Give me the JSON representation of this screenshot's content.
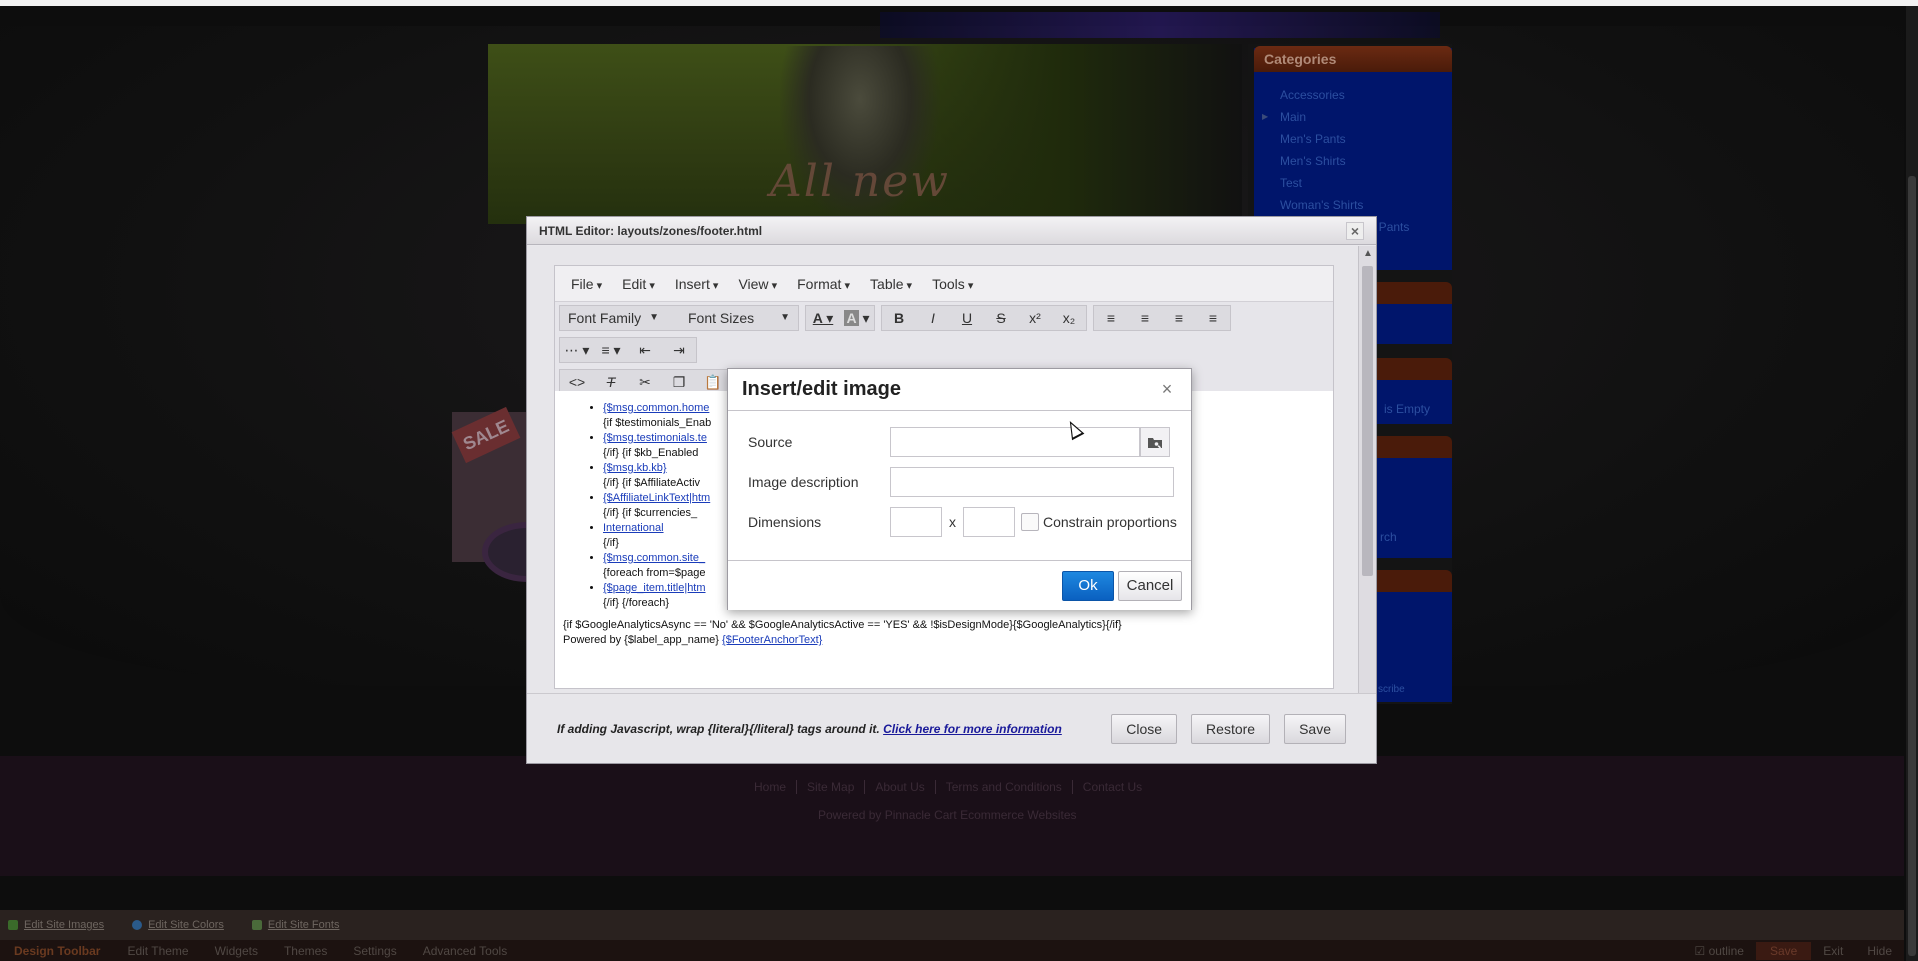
{
  "background_site": {
    "banner_text": "All new",
    "sale_tag": "SALE",
    "categories": {
      "title": "Categories",
      "items": [
        "Accessories",
        "Main",
        "Men's Pants",
        "Men's Shirts",
        "Test",
        "Woman's Shirts",
        "And Pants"
      ]
    },
    "sidebar_fragments": [
      "is Empty",
      "rch",
      "scribe"
    ],
    "footer_links": [
      "Home",
      "Site Map",
      "About Us",
      "Terms and Conditions",
      "Contact Us"
    ],
    "footer_powered": "Powered by Pinnacle Cart Ecommerce Websites"
  },
  "edit_toolbar": {
    "items": [
      {
        "label": "Edit Site Images",
        "color": "#3a6a2a"
      },
      {
        "label": "Edit Site Colors",
        "color": "#2a5a8a"
      },
      {
        "label": "Edit Site Fonts",
        "color": "#4a6a3a"
      }
    ]
  },
  "design_toolbar": {
    "brand": "Design Toolbar",
    "nav": [
      "Edit Theme",
      "Widgets",
      "Themes",
      "Settings",
      "Advanced Tools"
    ],
    "outline": "outline",
    "save": "Save",
    "exit": "Exit",
    "hide": "Hide"
  },
  "html_editor": {
    "title": "HTML Editor: layouts/zones/footer.html",
    "menubar": [
      "File",
      "Edit",
      "Insert",
      "View",
      "Format",
      "Table",
      "Tools"
    ],
    "font_family": "Font Family",
    "font_sizes": "Font Sizes",
    "content": {
      "list": [
        {
          "link": "{$msg.common.home",
          "text": "{if $testimonials_Enab"
        },
        {
          "link": "{$msg.testimonials.te",
          "text": "{/if} {if $kb_Enabled"
        },
        {
          "link": "{$msg.kb.kb}",
          "text": "{/if} {if $AffiliateActiv"
        },
        {
          "link": "{$AffiliateLinkText|htm",
          "text": "{/if} {if $currencies_"
        },
        {
          "link": "International",
          "text": "{/if}"
        },
        {
          "link": "{$msg.common.site_",
          "text": "{foreach from=$page"
        },
        {
          "link": "{$page_item.title|htm",
          "text": "{/if} {/foreach}"
        }
      ],
      "analytics_line": "{if $GoogleAnalyticsAsync == 'No' && $GoogleAnalyticsActive == 'YES' && !$isDesignMode}{$GoogleAnalytics}{/if}",
      "powered_prefix": "Powered by {$label_app_name}",
      "powered_link": "{$FooterAnchorText}"
    },
    "footer_note": "If adding Javascript, wrap {literal}{/literal} tags around it.",
    "footer_link": "Click here for more information",
    "buttons": {
      "close": "Close",
      "restore": "Restore",
      "save": "Save"
    }
  },
  "image_dialog": {
    "title": "Insert/edit image",
    "source_label": "Source",
    "source_value": "",
    "description_label": "Image description",
    "description_value": "",
    "dimensions_label": "Dimensions",
    "width_value": "",
    "height_value": "",
    "x_separator": "x",
    "constrain_label": "Constrain proportions",
    "ok": "Ok",
    "cancel": "Cancel"
  }
}
